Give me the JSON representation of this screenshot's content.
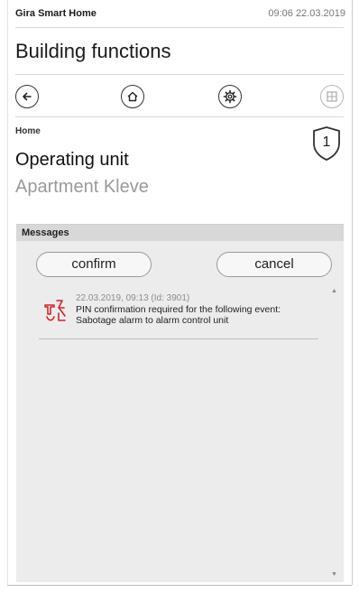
{
  "statusbar": {
    "app_name": "Gira Smart Home",
    "datetime": "09:06 22.03.2019"
  },
  "header": {
    "title": "Building functions"
  },
  "navbar": {
    "buttons": [
      {
        "icon": "back-arrow-icon"
      },
      {
        "icon": "home-icon"
      },
      {
        "icon": "settings-gear-icon"
      },
      {
        "icon": "grid-icon",
        "state": "disabled"
      }
    ]
  },
  "breadcrumb": "Home",
  "page": {
    "title": "Operating unit",
    "subtitle": "Apartment Kleve",
    "badge_number": "1",
    "badge_icon": "shield-icon"
  },
  "messages": {
    "header": "Messages",
    "confirm_label": "confirm",
    "cancel_label": "cancel",
    "items": [
      {
        "icon": "sabotage-alarm-icon",
        "meta": "22.03.2019, 09:13 (Id: 3901)",
        "text": "PIN confirmation required for the following event: Sabotage alarm to alarm control unit"
      }
    ]
  },
  "colors": {
    "alarm_icon": "#d2232a",
    "panel_bg": "#ececec",
    "header_bg": "#d8d8d8",
    "muted_text": "#9a9a9a"
  }
}
